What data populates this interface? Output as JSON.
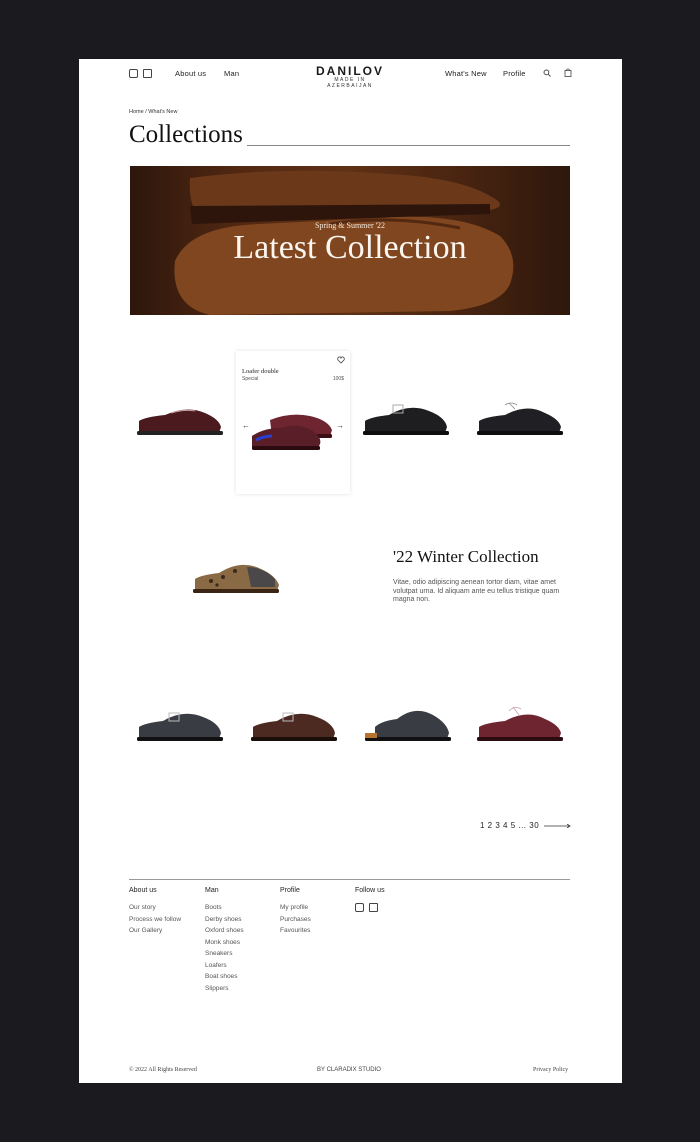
{
  "header": {
    "social_icons": [
      "instagram-icon",
      "facebook-icon"
    ],
    "nav_left": [
      "About us",
      "Man"
    ],
    "nav_right": [
      "What's New",
      "Profile"
    ],
    "logo_name": "DANILOV",
    "logo_sub": "MADE IN AZERBAIJAN",
    "action_icons": [
      "search-icon",
      "bag-icon"
    ]
  },
  "breadcrumb": {
    "home": "Home",
    "sep": "/",
    "current": "What's New"
  },
  "page_title": "Collections",
  "hero": {
    "kicker": "Spring & Summer '22",
    "title": "Latest Collection"
  },
  "featured_card": {
    "name": "Loafer double",
    "type": "Special",
    "price": "100$",
    "prev": "←",
    "next": "→"
  },
  "winter": {
    "title": "'22 Winter Collection",
    "text": "Vitae, odio adipiscing aenean tortor diam, vitae amet volutpat urna. Id aliquam ante eu tellus tristique quam magna non."
  },
  "colors": {
    "oxblood": "#4a1a1e",
    "burgundy": "#6e2530",
    "black": "#1e1e20",
    "charcoal": "#3a3c44",
    "brown": "#4c2a22",
    "leopard": "#8a6a45",
    "tan": "#9a5a2a"
  },
  "pagination": {
    "pages": "1 2 3 4 5 ... 30"
  },
  "footer": {
    "columns": [
      {
        "heading": "About us",
        "links": [
          "Our story",
          "Process we follow",
          "Our Gallery"
        ]
      },
      {
        "heading": "Man",
        "links": [
          "Boots",
          "Derby shoes",
          "Oxford shoes",
          "Monk shoes",
          "Sneakers",
          "Loafers",
          "Boat shoes",
          "Slippers"
        ]
      },
      {
        "heading": "Profile",
        "links": [
          "My profile",
          "Purchases",
          "Favourites"
        ]
      },
      {
        "heading": "Follow us",
        "links": []
      }
    ],
    "copyright": "© 2022 All Rights Reserved",
    "credit": "BY CLARADIX STUDIO",
    "privacy": "Privacy Policy"
  }
}
